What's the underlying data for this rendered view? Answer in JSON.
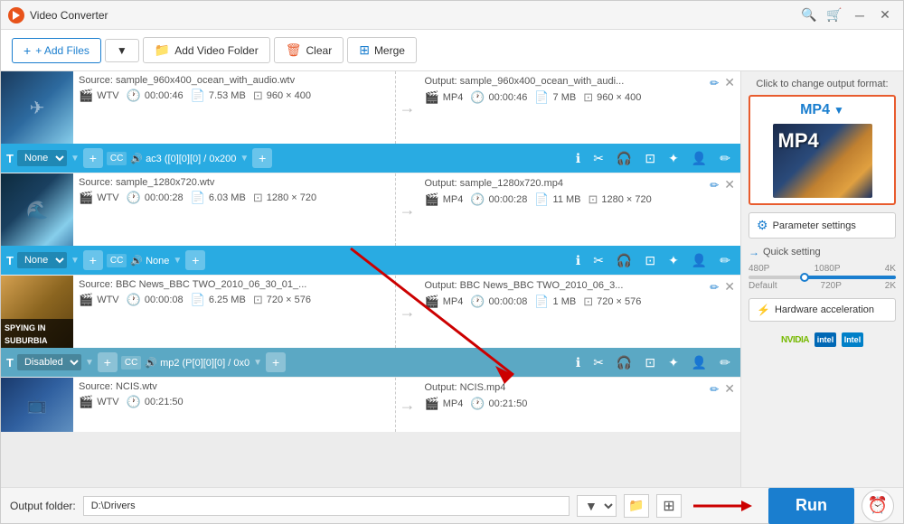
{
  "app": {
    "title": "Video Converter",
    "icon": "🎬"
  },
  "toolbar": {
    "add_files": "+ Add Files",
    "add_folder": "Add Video Folder",
    "clear": "Clear",
    "merge": "Merge",
    "add_files_arrow": "▼"
  },
  "files": [
    {
      "source_label": "Source: sample_960x400_ocean_with_audio.wtv",
      "output_label": "Output: sample_960x400_ocean_with_audi...",
      "source_format": "WTV",
      "source_duration": "00:00:46",
      "source_size": "7.53 MB",
      "source_resolution": "960 × 400",
      "output_format": "MP4",
      "output_duration": "00:00:46",
      "output_size": "7 MB",
      "output_resolution": "960 × 400",
      "track_type": "None",
      "track_audio": "ac3 ([0][0][0] / 0x200",
      "thumb_class": "thumb1"
    },
    {
      "source_label": "Source: sample_1280x720.wtv",
      "output_label": "Output: sample_1280x720.mp4",
      "source_format": "WTV",
      "source_duration": "00:00:28",
      "source_size": "6.03 MB",
      "source_resolution": "1280 × 720",
      "output_format": "MP4",
      "output_duration": "00:00:28",
      "output_size": "11 MB",
      "output_resolution": "1280 × 720",
      "track_type": "None",
      "track_audio": "None",
      "thumb_class": "thumb2"
    },
    {
      "source_label": "Source: BBC News_BBC TWO_2010_06_30_01_...",
      "output_label": "Output: BBC News_BBC TWO_2010_06_3...",
      "source_format": "WTV",
      "source_duration": "00:00:08",
      "source_size": "6.25 MB",
      "source_resolution": "720 × 576",
      "output_format": "MP4",
      "output_duration": "00:00:08",
      "output_size": "1 MB",
      "output_resolution": "720 × 576",
      "track_type": "Disabled",
      "track_audio": "mp2 (P[0][0][0] / 0x0",
      "thumb_class": "thumb3"
    },
    {
      "source_label": "Source: NCIS.wtv",
      "output_label": "Output: NCIS.mp4",
      "source_format": "WTV",
      "source_duration": "00:21:50",
      "source_size": "",
      "source_resolution": "",
      "output_format": "MP4",
      "output_duration": "00:21:50",
      "output_size": "",
      "output_resolution": "",
      "track_type": "",
      "track_audio": "",
      "thumb_class": "thumb4"
    }
  ],
  "right_panel": {
    "format_label": "Click to change output format:",
    "format_name": "MP4",
    "param_settings": "Parameter settings",
    "quick_setting": "Quick setting",
    "quality_labels_top": [
      "480P",
      "1080P",
      "4K"
    ],
    "quality_labels_bottom": [
      "Default",
      "720P",
      "2K"
    ],
    "hw_accel": "Hardware acceleration",
    "nvidia": "NVIDIA",
    "intel": "Intel"
  },
  "bottom": {
    "output_label": "Output folder:",
    "output_path": "D:\\Drivers",
    "run_label": "Run"
  },
  "track_labels": {
    "none": "None",
    "disabled": "Disabled",
    "add": "+",
    "cc": "cc",
    "info": "ℹ",
    "scissors": "✂",
    "headphone": "🎧",
    "crop": "⊡",
    "magic": "✦",
    "person": "👤",
    "edit": "✏"
  }
}
